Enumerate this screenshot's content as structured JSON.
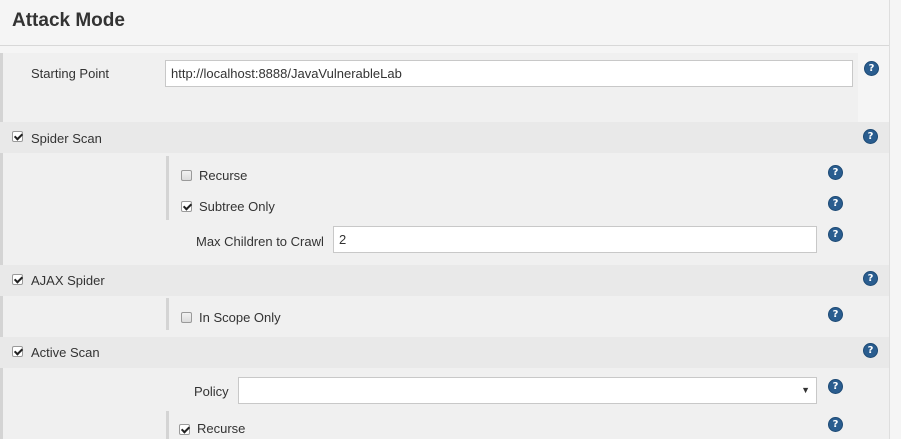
{
  "section_title": "Attack Mode",
  "starting_point": {
    "label": "Starting Point",
    "value": "http://localhost:8888/JavaVulnerableLab"
  },
  "spider_scan": {
    "label": "Spider Scan",
    "checked": true,
    "recurse": {
      "label": "Recurse",
      "checked": false
    },
    "subtree_only": {
      "label": "Subtree Only",
      "checked": true
    },
    "max_children": {
      "label": "Max Children to Crawl",
      "value": "2"
    }
  },
  "ajax_spider": {
    "label": "AJAX Spider",
    "checked": true,
    "in_scope_only": {
      "label": "In Scope Only",
      "checked": false
    }
  },
  "active_scan": {
    "label": "Active Scan",
    "checked": true,
    "policy": {
      "label": "Policy",
      "value": ""
    },
    "recurse": {
      "label": "Recurse",
      "checked": true
    }
  },
  "icons": {
    "help": "question-circle-icon",
    "dropdown": "caret-down-icon",
    "checkbox_checked": "check-icon"
  },
  "colors": {
    "help_icon": "#2a5d8f",
    "band": "#f0f0f0",
    "input_border": "#c8c8c8"
  }
}
